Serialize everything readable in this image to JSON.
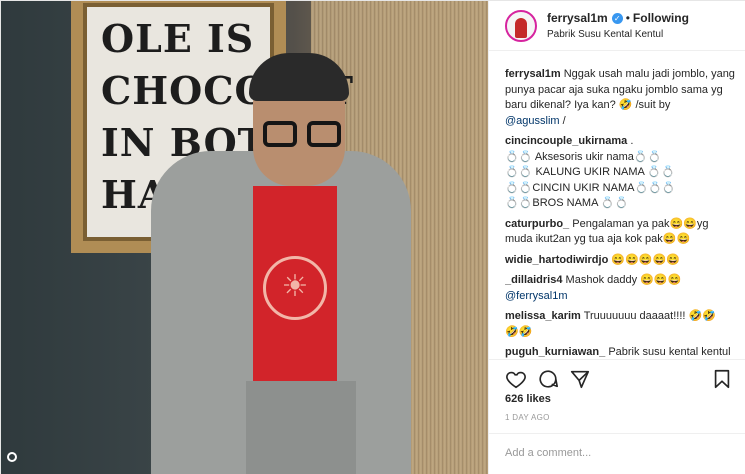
{
  "photo": {
    "frame_lines": [
      "OLE IS",
      "CHOCOLAT",
      "IN BOTH",
      "HANDS"
    ],
    "shirt_logo": "☀"
  },
  "header": {
    "username": "ferrysal1m",
    "verified_mark": "✓",
    "separator": "•",
    "follow_status": "Following",
    "location": "Pabrik Susu Kental Kentul"
  },
  "caption": {
    "username": "ferrysal1m",
    "text": "Nggak usah malu jadi jomblo, yang punya pacar aja suka ngaku jomblo sama yg baru dikenal? Iya kan? 🤣 /suit by",
    "mention": "@agusslim",
    "tail": " /"
  },
  "comments": [
    {
      "username": "cincincouple_ukirnama",
      "lines": [
        ".",
        "💍💍 Aksesoris ukir nama💍💍",
        "💍💍 KALUNG UKIR NAMA 💍💍",
        "💍💍CINCIN UKIR NAMA💍💍💍",
        "💍💍BROS NAMA 💍💍"
      ]
    },
    {
      "username": "caturpurbo_",
      "lines": [
        "Pengalaman ya pak😄😄yg muda ikut2an yg tua aja kok pak😄😄"
      ]
    },
    {
      "username": "widie_hartodiwirdjo",
      "lines": [
        "😄😄😄😄😄"
      ]
    },
    {
      "username": "_dillaidris4",
      "lines": [
        "Mashok daddy 😄😄😄"
      ],
      "mention": "@ferrysal1m"
    },
    {
      "username": "melissa_karim",
      "lines": [
        "Truuuuuuu daaaat!!!! 🤣🤣",
        "🤣🤣"
      ]
    },
    {
      "username": "puguh_kurniawan_",
      "lines": [
        "Pabrik susu kental kentul😄😄😄"
      ]
    }
  ],
  "actions": {
    "like_icon": "heart-icon",
    "comment_icon": "comment-icon",
    "share_icon": "share-icon",
    "save_icon": "bookmark-icon"
  },
  "likes": "626 likes",
  "time_ago": "1 DAY AGO",
  "add_comment_placeholder": "Add a comment..."
}
